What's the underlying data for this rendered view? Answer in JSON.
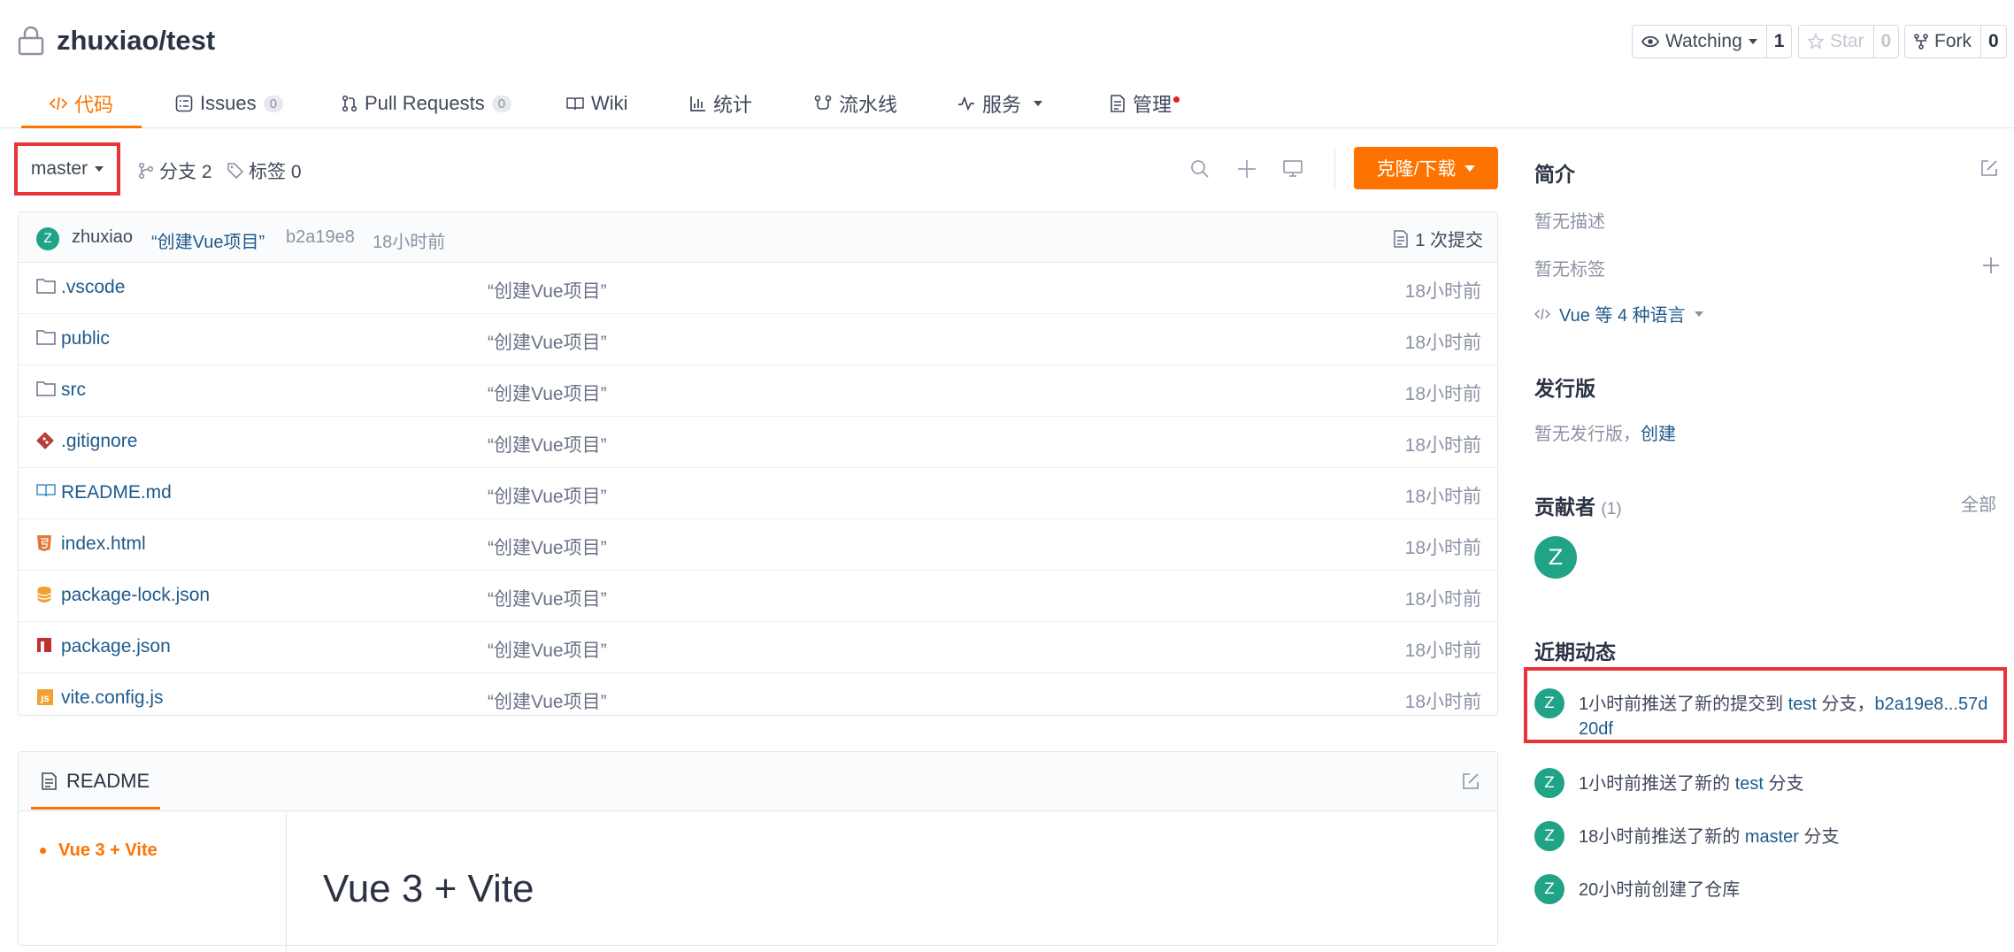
{
  "repo": {
    "owner_repo": "zhuxiao/test"
  },
  "header_actions": {
    "watch": {
      "label": "Watching",
      "count": "1"
    },
    "star": {
      "label": "Star",
      "count": "0"
    },
    "fork": {
      "label": "Fork",
      "count": "0"
    }
  },
  "tabs": [
    {
      "label": "代码"
    },
    {
      "label": "Issues",
      "badge": "0"
    },
    {
      "label": "Pull Requests",
      "badge": "0"
    },
    {
      "label": "Wiki"
    },
    {
      "label": "统计"
    },
    {
      "label": "流水线"
    },
    {
      "label": "服务"
    },
    {
      "label": "管理"
    }
  ],
  "toolbar": {
    "branch": "master",
    "branches": "分支 2",
    "tags": "标签 0",
    "clone_label": "克隆/下载"
  },
  "commit": {
    "avatar": "Z",
    "author": "zhuxiao",
    "message": "“创建Vue项目”",
    "hash": "b2a19e8",
    "time": "18小时前",
    "count": "1 次提交"
  },
  "files": [
    {
      "name": ".vscode",
      "message": "“创建Vue项目”",
      "time": "18小时前",
      "icon": "folder-icon"
    },
    {
      "name": "public",
      "message": "“创建Vue项目”",
      "time": "18小时前",
      "icon": "folder-icon"
    },
    {
      "name": "src",
      "message": "“创建Vue项目”",
      "time": "18小时前",
      "icon": "folder-icon"
    },
    {
      "name": ".gitignore",
      "message": "“创建Vue项目”",
      "time": "18小时前",
      "icon": "git-icon"
    },
    {
      "name": "README.md",
      "message": "“创建Vue项目”",
      "time": "18小时前",
      "icon": "book-icon"
    },
    {
      "name": "index.html",
      "message": "“创建Vue项目”",
      "time": "18小时前",
      "icon": "html5-icon"
    },
    {
      "name": "package-lock.json",
      "message": "“创建Vue项目”",
      "time": "18小时前",
      "icon": "database-icon"
    },
    {
      "name": "package.json",
      "message": "“创建Vue项目”",
      "time": "18小时前",
      "icon": "npm-icon"
    },
    {
      "name": "vite.config.js",
      "message": "“创建Vue项目”",
      "time": "18小时前",
      "icon": "js-icon"
    }
  ],
  "readme": {
    "tab_label": "README",
    "toc": [
      "Vue 3 + Vite"
    ],
    "heading": "Vue 3 + Vite"
  },
  "sidebar": {
    "intro_title": "简介",
    "no_description": "暂无描述",
    "no_tags": "暂无标签",
    "languages": "Vue 等 4 种语言",
    "releases_title": "发行版",
    "no_releases": "暂无发行版，",
    "create_link": "创建",
    "contributors_title": "贡献者",
    "contributors_count": "(1)",
    "all_link": "全部",
    "contributor_avatar": "Z",
    "activity_title": "近期动态",
    "activities": [
      {
        "avatar": "Z",
        "prefix": "1小时前推送了新的提交到 ",
        "branch": "test",
        "middle": " 分支，",
        "link": "b2a19e8...57d",
        "link2": "20df",
        "suffix": ""
      },
      {
        "avatar": "Z",
        "prefix": "1小时前推送了新的 ",
        "branch": "test",
        "middle": " 分支",
        "link": "",
        "link2": "",
        "suffix": ""
      },
      {
        "avatar": "Z",
        "prefix": "18小时前推送了新的 ",
        "branch": "master",
        "middle": " 分支",
        "link": "",
        "link2": "",
        "suffix": ""
      },
      {
        "avatar": "Z",
        "prefix": "20小时前创建了仓库",
        "branch": "",
        "middle": "",
        "link": "",
        "link2": "",
        "suffix": ""
      }
    ]
  },
  "colors": {
    "accent": "#fe7300",
    "link": "#1e5a8c",
    "avatar": "#20a386",
    "highlight": "#e8333a"
  }
}
